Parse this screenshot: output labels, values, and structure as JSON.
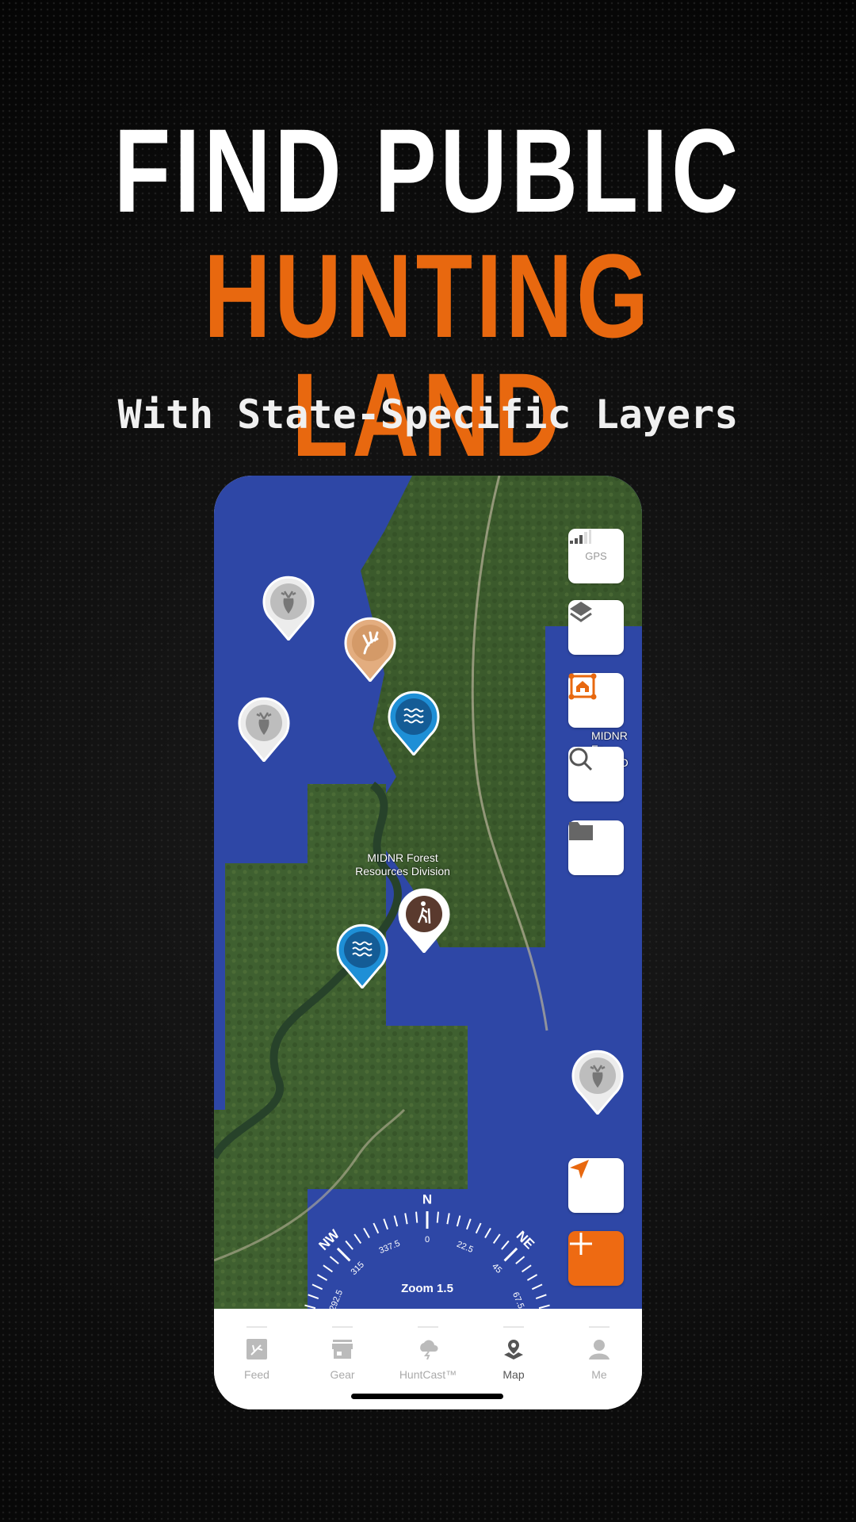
{
  "headline": {
    "line1": "FIND PUBLIC",
    "line2": "HUNTING LAND",
    "subtitle": "With State-Specific Layers"
  },
  "colors": {
    "accent": "#e8680f",
    "water_overlay": "#2e47a6",
    "forest": "#3b5a2c",
    "water_pin": "#1e8fd6",
    "shed_pin": "#d49a68",
    "trail_pin": "#5a3a2e",
    "deer_pin": "#bdbdbd"
  },
  "map": {
    "labels": [
      {
        "text1": "MIDNR Forest",
        "text2": "Resources Division"
      },
      {
        "text1": "MIDNR Fo",
        "text2": "es D"
      }
    ],
    "pins": [
      {
        "type": "deer",
        "icon": "deer-head-icon"
      },
      {
        "type": "shed",
        "icon": "antler-icon"
      },
      {
        "type": "deer",
        "icon": "deer-head-icon"
      },
      {
        "type": "water",
        "icon": "water-waves-icon"
      },
      {
        "type": "trail",
        "icon": "hiker-icon"
      },
      {
        "type": "water",
        "icon": "water-waves-icon"
      },
      {
        "type": "deer",
        "icon": "deer-head-icon"
      }
    ],
    "controls": {
      "gps_label": "GPS",
      "gps_signal_bars": 3,
      "icons": [
        "gps-signal-icon",
        "layers-icon",
        "property-boundary-icon",
        "search-icon",
        "folder-icon",
        "locate-arrow-icon",
        "plus-icon"
      ]
    },
    "compass": {
      "cardinals": [
        "NW",
        "N",
        "NE"
      ],
      "degrees": [
        "292.5",
        "315",
        "337.5",
        "0",
        "22.5",
        "45",
        "67.5"
      ],
      "zoom_text": "Zoom 1.5"
    }
  },
  "nav": {
    "tabs": [
      {
        "label": "Feed"
      },
      {
        "label": "Gear"
      },
      {
        "label": "HuntCast™"
      },
      {
        "label": "Map",
        "active": true
      },
      {
        "label": "Me"
      }
    ]
  }
}
